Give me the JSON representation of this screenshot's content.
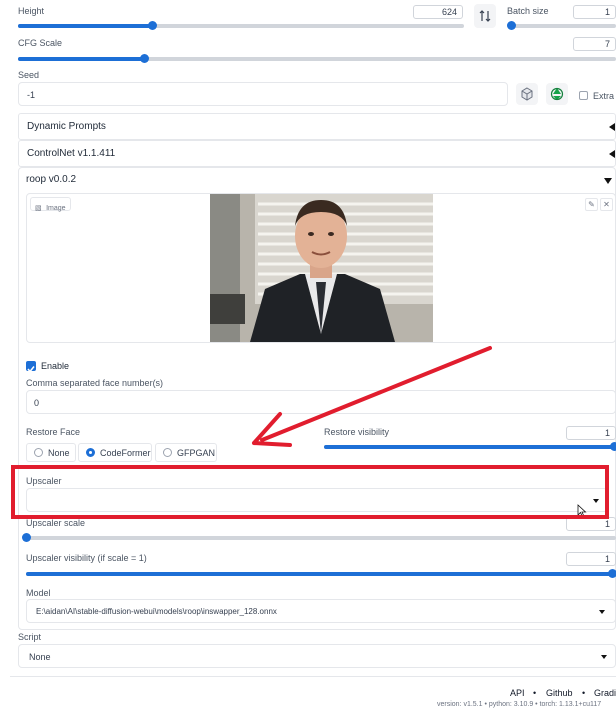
{
  "height": {
    "label": "Height",
    "value": "624",
    "fraction": 0.3
  },
  "swap_icon": "swap-vertical-icon",
  "batch_size": {
    "label": "Batch size",
    "value": "1",
    "fraction": 0.0
  },
  "cfg_scale": {
    "label": "CFG Scale",
    "value": "7",
    "fraction": 0.2
  },
  "seed": {
    "label": "Seed",
    "value": "-1",
    "extra_label": "Extra"
  },
  "accordions": {
    "dynamic_prompts": "Dynamic Prompts",
    "controlnet": "ControlNet v1.1.411",
    "roop": "roop v0.0.2"
  },
  "roop": {
    "image_label": "Image",
    "enable_label": "Enable",
    "enable_checked": true,
    "face_numbers_label": "Comma separated face number(s)",
    "face_numbers_value": "0",
    "restore_face_label": "Restore Face",
    "restore_face_options": [
      "None",
      "CodeFormer",
      "GFPGAN"
    ],
    "restore_face_selected": "CodeFormer",
    "restore_visibility_label": "Restore visibility",
    "restore_visibility_value": "1",
    "restore_visibility_fraction": 1.0,
    "upscaler_label": "Upscaler",
    "upscaler_value": "",
    "upscaler_scale_label": "Upscaler scale",
    "upscaler_scale_value": "1",
    "upscaler_scale_fraction": 0.0,
    "upscaler_visibility_label": "Upscaler visibility (if scale = 1)",
    "upscaler_visibility_value": "1",
    "upscaler_visibility_fraction": 1.0,
    "model_label": "Model",
    "model_value": "E:\\aidan\\AI\\stable-diffusion-webui\\models\\roop\\inswapper_128.onnx"
  },
  "script": {
    "label": "Script",
    "value": "None"
  },
  "footer": {
    "links": [
      "API",
      "Github",
      "Gradi"
    ],
    "version_text": "version: v1.5.1  •  python: 3.10.9  •  torch: 1.13.1+cu117"
  },
  "colors": {
    "accent": "#1d6fd6",
    "annotation_red": "#e11d2e"
  }
}
